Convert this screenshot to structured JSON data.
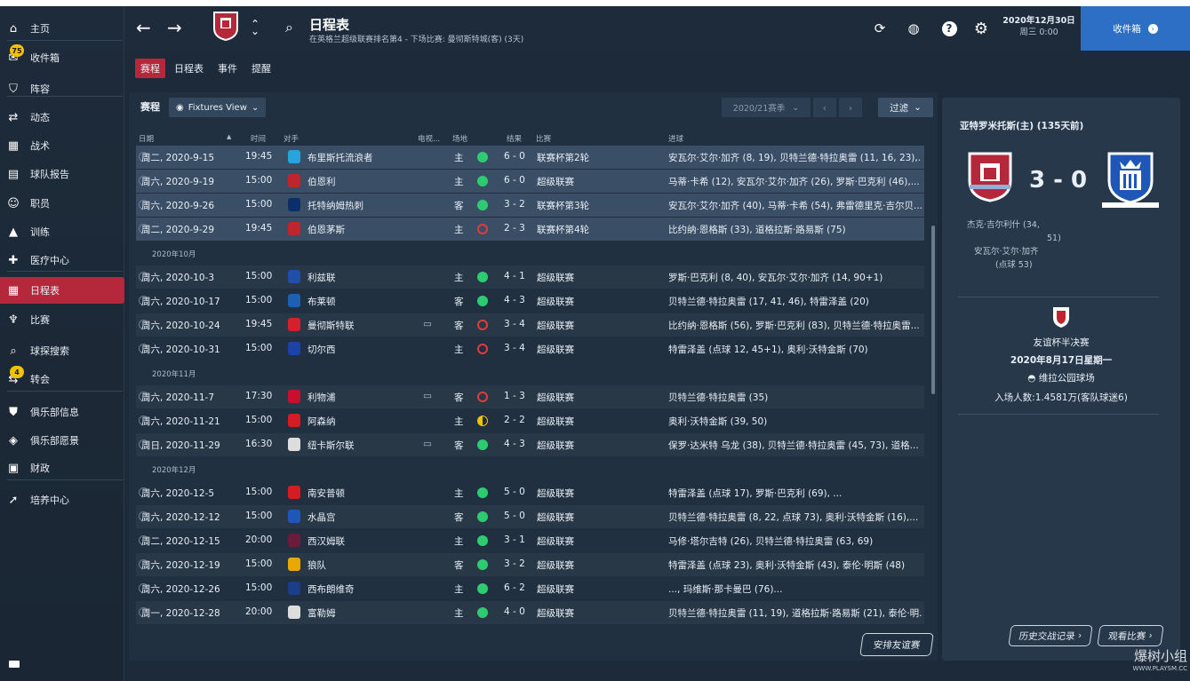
{
  "sidebar": {
    "items": [
      {
        "label": "主页",
        "icon": "home-icon"
      },
      {
        "label": "收件箱",
        "icon": "inbox-icon",
        "badge": "75"
      },
      {
        "label": "阵容",
        "icon": "jersey-icon"
      },
      {
        "label": "动态",
        "icon": "dynamics-icon"
      },
      {
        "label": "战术",
        "icon": "tactics-icon"
      },
      {
        "label": "球队报告",
        "icon": "report-icon"
      },
      {
        "label": "职员",
        "icon": "staff-icon"
      },
      {
        "label": "训练",
        "icon": "training-icon"
      },
      {
        "label": "医疗中心",
        "icon": "medical-icon"
      },
      {
        "label": "日程表",
        "icon": "calendar-icon"
      },
      {
        "label": "比赛",
        "icon": "trophy-icon"
      },
      {
        "label": "球探搜索",
        "icon": "search-icon"
      },
      {
        "label": "转会",
        "icon": "transfer-icon",
        "badge": "4"
      },
      {
        "label": "俱乐部信息",
        "icon": "shield-icon"
      },
      {
        "label": "俱乐部愿景",
        "icon": "vision-icon"
      },
      {
        "label": "财政",
        "icon": "finance-icon"
      },
      {
        "label": "培养中心",
        "icon": "development-icon"
      }
    ]
  },
  "header": {
    "title": "日程表",
    "subtitle": "在英格兰超级联赛排名第4 - 下场比赛: 曼彻斯特城(客) (3天)",
    "date": "2020年12月30日",
    "time": "周三 0:00",
    "inbox_label": "收件箱"
  },
  "tabs": [
    "赛程",
    "日程表",
    "事件",
    "提醒"
  ],
  "toolbar": {
    "title": "赛程",
    "view": "Fixtures View",
    "season": "2020/21赛季",
    "filter": "过滤"
  },
  "columns": {
    "date": "日期",
    "time": "时间",
    "opponent": "对手",
    "tv": "电视...",
    "venue": "场地",
    "result": "结果",
    "comp": "比赛",
    "goals": "进球"
  },
  "months": [
    "2020年10月",
    "2020年11月",
    "2020年12月"
  ],
  "fixtures": [
    {
      "date": "周二, 2020-9-15",
      "time": "19:45",
      "opp": "布里斯托流浪者",
      "tv": "",
      "venue": "主",
      "res": "w",
      "score": "6 - 0",
      "comp": "联赛杯第2轮",
      "goals": "安瓦尔·艾尔·加齐 (8, 19), 贝特兰德·特拉奥雷 (11, 16, 23),..."
    },
    {
      "date": "周六, 2020-9-19",
      "time": "15:00",
      "opp": "伯恩利",
      "tv": "",
      "venue": "主",
      "res": "w",
      "score": "6 - 0",
      "comp": "超级联赛",
      "goals": "马蒂·卡希 (12), 安瓦尔·艾尔·加齐 (26), 罗斯·巴克利 (46),..."
    },
    {
      "date": "周六, 2020-9-26",
      "time": "15:00",
      "opp": "托特纳姆热刺",
      "tv": "",
      "venue": "客",
      "res": "w",
      "score": "3 - 2",
      "comp": "联赛杯第3轮",
      "goals": "安瓦尔·艾尔·加齐 (40), 马蒂·卡希 (54), 弗雷德里克·吉尔贝..."
    },
    {
      "date": "周二, 2020-9-29",
      "time": "19:45",
      "opp": "伯恩茅斯",
      "tv": "",
      "venue": "主",
      "res": "l",
      "score": "2 - 3",
      "comp": "联赛杯第4轮",
      "goals": "比约纳·恩格斯 (33), 道格拉斯·路易斯 (75)"
    },
    {
      "date": "周六, 2020-10-3",
      "time": "15:00",
      "opp": "利兹联",
      "tv": "",
      "venue": "主",
      "res": "w",
      "score": "4 - 1",
      "comp": "超级联赛",
      "goals": "罗斯·巴克利 (8, 40), 安瓦尔·艾尔·加齐 (14, 90+1)"
    },
    {
      "date": "周六, 2020-10-17",
      "time": "15:00",
      "opp": "布莱顿",
      "tv": "",
      "venue": "客",
      "res": "w",
      "score": "4 - 3",
      "comp": "超级联赛",
      "goals": "贝特兰德·特拉奥雷 (17, 41, 46), 特雷泽盖 (20)"
    },
    {
      "date": "周六, 2020-10-24",
      "time": "19:45",
      "opp": "曼彻斯特联",
      "tv": "▭",
      "venue": "客",
      "res": "l",
      "score": "3 - 4",
      "comp": "超级联赛",
      "goals": "比约纳·恩格斯 (56), 罗斯·巴克利 (83), 贝特兰德·特拉奥雷..."
    },
    {
      "date": "周六, 2020-10-31",
      "time": "15:00",
      "opp": "切尔西",
      "tv": "",
      "venue": "主",
      "res": "l",
      "score": "3 - 4",
      "comp": "超级联赛",
      "goals": "特雷泽盖 (点球 12, 45+1), 奥利·沃特金斯 (70)"
    },
    {
      "date": "周六, 2020-11-7",
      "time": "17:30",
      "opp": "利物浦",
      "tv": "▭",
      "venue": "客",
      "res": "l",
      "score": "1 - 3",
      "comp": "超级联赛",
      "goals": "贝特兰德·特拉奥雷 (35)"
    },
    {
      "date": "周六, 2020-11-21",
      "time": "15:00",
      "opp": "阿森纳",
      "tv": "",
      "venue": "主",
      "res": "d",
      "score": "2 - 2",
      "comp": "超级联赛",
      "goals": "奥利·沃特金斯 (39, 50)"
    },
    {
      "date": "周日, 2020-11-29",
      "time": "16:30",
      "opp": "纽卡斯尔联",
      "tv": "▭",
      "venue": "客",
      "res": "w",
      "score": "4 - 3",
      "comp": "超级联赛",
      "goals": "保罗·达米特 乌龙 (38), 贝特兰德·特拉奥雷 (45, 73), 道格..."
    },
    {
      "date": "周六, 2020-12-5",
      "time": "15:00",
      "opp": "南安普顿",
      "tv": "",
      "venue": "主",
      "res": "w",
      "score": "5 - 0",
      "comp": "超级联赛",
      "goals": "特雷泽盖 (点球 17), 罗斯·巴克利 (69), ..."
    },
    {
      "date": "周六, 2020-12-12",
      "time": "15:00",
      "opp": "水晶宫",
      "tv": "",
      "venue": "客",
      "res": "w",
      "score": "5 - 0",
      "comp": "超级联赛",
      "goals": "贝特兰德·特拉奥雷 (8, 22, 点球 73), 奥利·沃特金斯 (16),..."
    },
    {
      "date": "周二, 2020-12-15",
      "time": "20:00",
      "opp": "西汉姆联",
      "tv": "",
      "venue": "主",
      "res": "w",
      "score": "3 - 1",
      "comp": "超级联赛",
      "goals": "马修·塔尔吉特 (26), 贝特兰德·特拉奥雷 (63, 69)"
    },
    {
      "date": "周六, 2020-12-19",
      "time": "15:00",
      "opp": "狼队",
      "tv": "",
      "venue": "客",
      "res": "w",
      "score": "3 - 2",
      "comp": "超级联赛",
      "goals": "特雷泽盖 (点球 23), 奥利·沃特金斯 (43), 泰伦·明斯 (48)"
    },
    {
      "date": "周六, 2020-12-26",
      "time": "15:00",
      "opp": "西布朗维奇",
      "tv": "",
      "venue": "主",
      "res": "w",
      "score": "6 - 2",
      "comp": "超级联赛",
      "goals": "..., 玛维斯·那卡曼巴 (76)..."
    },
    {
      "date": "周一, 2020-12-28",
      "time": "20:00",
      "opp": "富勒姆",
      "tv": "",
      "venue": "主",
      "res": "w",
      "score": "4 - 0",
      "comp": "超级联赛",
      "goals": "贝特兰德·特拉奥雷 (11, 19), 道格拉斯·路易斯 (21), 泰伦·明..."
    }
  ],
  "friendly_button": "安排友谊赛",
  "match_panel": {
    "title": "亚特罗米托斯(主) (135天前)",
    "score": "3 - 0",
    "scorers": [
      "杰克·吉尔利什 (34,",
      "51)",
      "安瓦尔·艾尔·加齐",
      "(点球 53)"
    ],
    "competition": "友谊杯半决赛",
    "date": "2020年8月17日星期一",
    "stadium": "维拉公园球场",
    "attendance": "入场人数:1.4581万(客队球迷6)",
    "btn_history": "历史交战记录",
    "btn_watch": "观看比赛"
  },
  "watermark": "爆树小组",
  "watermark_url": "WWW.PLAYSM.CC",
  "colors": {
    "accent": "#b5283b",
    "inbox": "#2d6fc4",
    "win": "#2ecc71",
    "loss": "#e23b3b",
    "draw": "#f2c200"
  }
}
